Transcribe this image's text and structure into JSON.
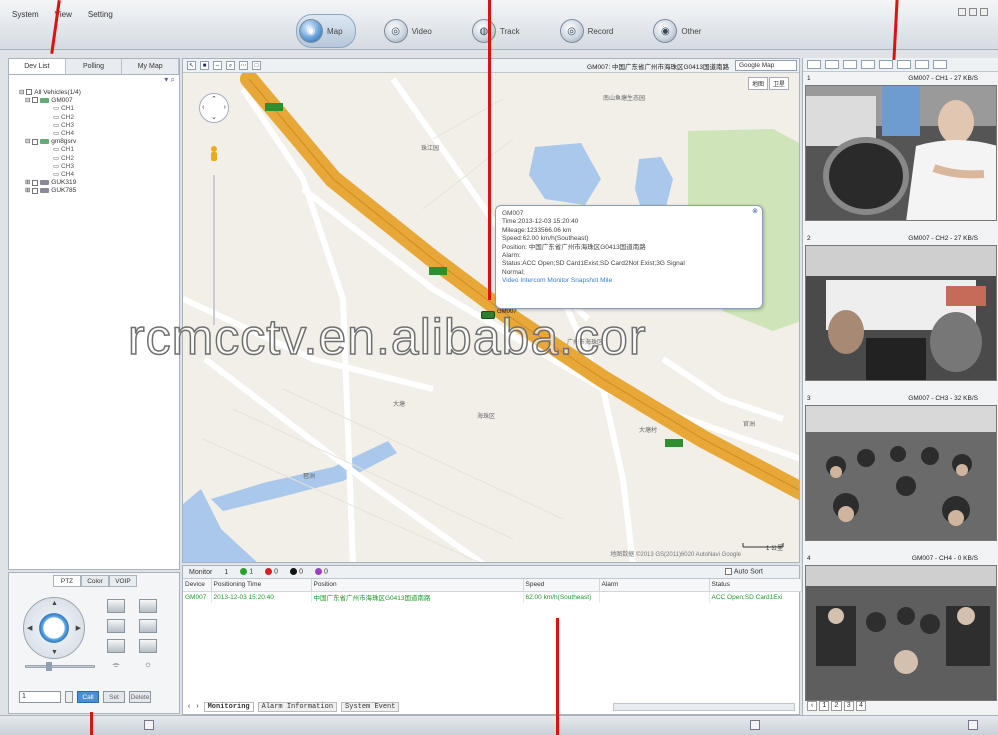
{
  "menu": [
    "System",
    "View",
    "Setting"
  ],
  "nav": [
    {
      "label": "Map",
      "icon": "globe-icon",
      "glyph": "◉"
    },
    {
      "label": "Video",
      "icon": "camera-icon",
      "glyph": "◎"
    },
    {
      "label": "Track",
      "icon": "track-icon",
      "glyph": "◍"
    },
    {
      "label": "Record",
      "icon": "record-icon",
      "glyph": "◎"
    },
    {
      "label": "Other",
      "icon": "settings-icon",
      "glyph": "◉"
    }
  ],
  "left_tabs": [
    "Dev List",
    "Polling",
    "My Map"
  ],
  "tree": {
    "root": "All Vehicles(1/4)",
    "vehicles": [
      {
        "name": "GM007",
        "channels": [
          "CH1",
          "CH2",
          "CH3",
          "CH4"
        ]
      },
      {
        "name": "gm8gsrv",
        "channels": [
          "CH1",
          "CH2",
          "CH3",
          "CH4"
        ]
      },
      {
        "name": "GUK319",
        "channels": []
      },
      {
        "name": "GUK785",
        "channels": []
      }
    ]
  },
  "ptz": {
    "tabs": [
      "PTZ",
      "Color",
      "VOIP"
    ],
    "preset_value": "1",
    "buttons": [
      "Call",
      "Set",
      "Delete"
    ]
  },
  "map": {
    "title": "GM007: 中国广东省广州市海珠区G0413国道南路",
    "type_select": "Google Map",
    "type_buttons": [
      "地图",
      "卫星"
    ],
    "vehicle_label": "GM007",
    "copyright": "地图数据 ©2013 GS(2011)6020 AutoNavi Google",
    "scale_label": "1 公里",
    "labels": [
      "南山鱼塘生态园",
      "珠江园",
      "广州市海珠区",
      "大塘村",
      "海珠区",
      "琶洲",
      "大塘",
      "官洲"
    ],
    "popup": {
      "title": "GM007",
      "lines": [
        "Time:2013-12-03 15:20:40",
        "Mileage:1233566.06 km",
        "Speed:62.00 km/h(Southeast)",
        "Position: 中国广东省广州市海珠区G0413国道南路",
        "Alarm:",
        "Status:ACC Open;SD Card1Exist;SD Card2Not Exist;3G Signal",
        "Normal;"
      ],
      "links": "Video  Intercom  Monitor  Snapshot  Mile"
    }
  },
  "watermark": "rcmcctv.en.alibaba.cor",
  "monitor": {
    "label": "Monitor",
    "counts": [
      {
        "value": "1",
        "color": "#2aa02a"
      },
      {
        "value": "1",
        "color": "#2aa02a"
      },
      {
        "value": "0",
        "color": "#d42020"
      },
      {
        "value": "0",
        "color": "#111111"
      },
      {
        "value": "0",
        "color": "#9a3fc0"
      }
    ],
    "auto_sort": "Auto Sort",
    "columns": [
      "Device",
      "Positioning Time",
      "Position",
      "Speed",
      "Alarm",
      "Status"
    ],
    "rows": [
      [
        "GM007",
        "2013-12-03 15:20:40",
        "中国广东省广州市海珠区G0413国道南路",
        "62.00 km/h(Southeast)",
        "",
        "ACC Open;SD Card1Exi"
      ]
    ],
    "tabs": [
      "Monitoring",
      "Alarm Information",
      "System Event"
    ]
  },
  "video": {
    "tiles": [
      {
        "index": "1",
        "title": "GM007 - CH1 - 27 KB/S"
      },
      {
        "index": "2",
        "title": "GM007 - CH2 - 27 KB/S"
      },
      {
        "index": "3",
        "title": "GM007 - CH3 - 32 KB/S"
      },
      {
        "index": "4",
        "title": "GM007 - CH4 - 0 KB/S"
      }
    ],
    "pages": [
      "1",
      "2",
      "3",
      "4"
    ]
  },
  "colors": {
    "accent": "#4b8fd6",
    "road": "#e8a838",
    "active_text": "#1e9a2a",
    "annotation": "#d11111"
  }
}
